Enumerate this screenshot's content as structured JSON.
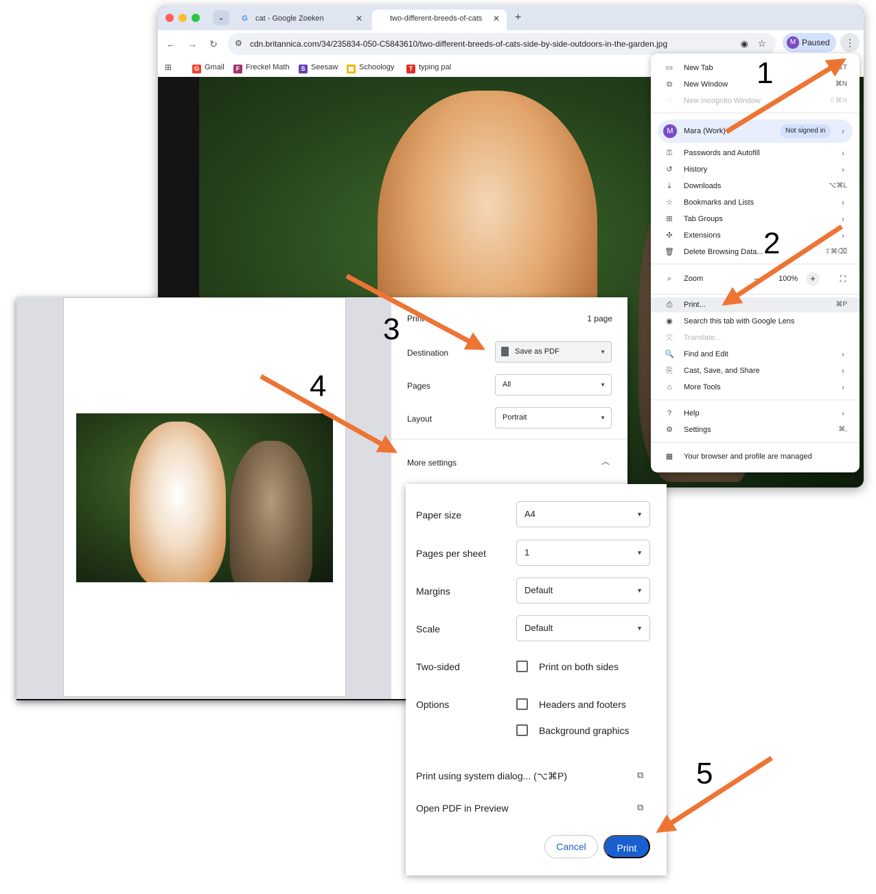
{
  "browser": {
    "tabs": [
      {
        "title": "cat - Google Zoeken",
        "favicon": "google-icon"
      },
      {
        "title": "two-different-breeds-of-cats",
        "favicon": "image-icon"
      }
    ],
    "url": "cdn.britannica.com/34/235834-050-C5843610/two-different-breeds-of-cats-side-by-side-outdoors-in-the-garden.jpg",
    "profile_initial": "M",
    "profile_status": "Paused",
    "bookmarks": [
      {
        "label": "Gmail",
        "color": "#ea4335",
        "glyph": "G"
      },
      {
        "label": "Freckel Math",
        "color": "#a1346c",
        "glyph": "F"
      },
      {
        "label": "Seesaw",
        "color": "#6a3fb5",
        "glyph": "S"
      },
      {
        "label": "Schoology",
        "color": "#f4b400",
        "glyph": "▦"
      },
      {
        "label": "typing pal",
        "color": "#d93025",
        "glyph": "T"
      }
    ]
  },
  "menu": {
    "new_tab": {
      "label": "New Tab",
      "shortcut": "⌘T"
    },
    "new_window": {
      "label": "New Window",
      "shortcut": "⌘N"
    },
    "new_incognito": {
      "label": "New Incognito Window",
      "shortcut": "⇧⌘N"
    },
    "profile": {
      "initial": "M",
      "name": "Mara (Work)",
      "badge": "Not signed in"
    },
    "passwords": {
      "label": "Passwords and Autofill"
    },
    "history": {
      "label": "History"
    },
    "downloads": {
      "label": "Downloads",
      "shortcut": "⌥⌘L"
    },
    "bookmarks": {
      "label": "Bookmarks and Lists"
    },
    "tab_groups": {
      "label": "Tab Groups"
    },
    "extensions": {
      "label": "Extensions"
    },
    "delete_data": {
      "label": "Delete Browsing Data...",
      "shortcut": "⇧⌘⌫"
    },
    "zoom": {
      "label": "Zoom",
      "minus": "−",
      "value": "100%",
      "plus": "+"
    },
    "print": {
      "label": "Print...",
      "shortcut": "⌘P"
    },
    "lens": {
      "label": "Search this tab with Google Lens"
    },
    "translate": {
      "label": "Translate..."
    },
    "find_edit": {
      "label": "Find and Edit"
    },
    "cast": {
      "label": "Cast, Save, and Share"
    },
    "more_tools": {
      "label": "More Tools"
    },
    "help": {
      "label": "Help"
    },
    "settings": {
      "label": "Settings",
      "shortcut": "⌘,"
    },
    "managed": {
      "label": "Your browser and profile are managed"
    }
  },
  "print_dialog": {
    "title": "Print",
    "page_count": "1 page",
    "destination": {
      "label": "Destination",
      "value": "Save as PDF"
    },
    "pages": {
      "label": "Pages",
      "value": "All"
    },
    "layout": {
      "label": "Layout",
      "value": "Portrait"
    },
    "more_settings": "More settings"
  },
  "more_settings": {
    "paper_size": {
      "label": "Paper size",
      "value": "A4"
    },
    "pages_per_sheet": {
      "label": "Pages per sheet",
      "value": "1"
    },
    "margins": {
      "label": "Margins",
      "value": "Default"
    },
    "scale": {
      "label": "Scale",
      "value": "Default"
    },
    "two_sided": {
      "label": "Two-sided",
      "option": "Print on both sides"
    },
    "options": {
      "label": "Options",
      "headers_footers": "Headers and footers",
      "background_graphics": "Background graphics"
    },
    "system_dialog": "Print using system dialog... (⌥⌘P)",
    "open_pdf": "Open PDF in Preview",
    "cancel": "Cancel",
    "print": "Print"
  },
  "annotations": [
    "1",
    "2",
    "3",
    "4",
    "5"
  ],
  "colors": {
    "arrow": "#ee7434",
    "accent": "#1a5fd0"
  }
}
